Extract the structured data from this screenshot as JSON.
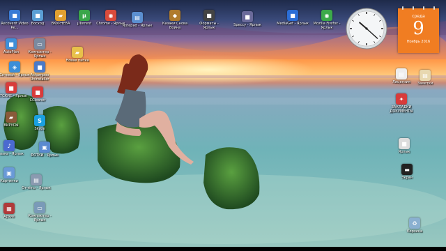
{
  "clock": {
    "time": "10:22"
  },
  "calendar": {
    "weekday": "среда",
    "day": "9",
    "month_year": "Ноябрь 2016"
  },
  "colors": {
    "calendar": "#f07d22",
    "sky_top": "#1e2a4a",
    "sunset": "#ff9a4a",
    "sea": "#6fb3b8"
  },
  "icons": [
    {
      "label": "Recoverit Video Re...",
      "icon": "app-icon",
      "color": "#3a7bd5"
    },
    {
      "label": "Восход",
      "icon": "app-icon",
      "color": "#5a9fd4"
    },
    {
      "label": "ВКУРНЕВА",
      "icon": "folder-icon",
      "color": "#e0a030"
    },
    {
      "label": "µTorrent",
      "icon": "torrent-icon",
      "color": "#3aa64a"
    },
    {
      "label": "Chrome - Ярлык",
      "icon": "browser-icon",
      "color": "#d94b3b"
    },
    {
      "label": "Notepad - Ярлык",
      "icon": "document-icon",
      "color": "#5b8fd0"
    },
    {
      "label": "Казаки Снова Война",
      "icon": "game-icon",
      "color": "#b07b2c"
    },
    {
      "label": "Форматы - Ярлык",
      "icon": "app-icon",
      "color": "#444444"
    },
    {
      "label": "Speccy - Ярлык",
      "icon": "app-icon",
      "color": "#6a6a9a"
    },
    {
      "label": "MediaGet - Ярлык",
      "icon": "app-icon",
      "color": "#2b6ed6"
    },
    {
      "label": "Mozilla Firefox - Ярлык",
      "icon": "browser-icon",
      "color": "#3caa4a"
    },
    {
      "label": "AutoPlan",
      "icon": "app-icon",
      "color": "#3f8fd8"
    },
    {
      "label": "Компьютер - Ярлык",
      "icon": "computer-icon",
      "color": "#7a8aa0"
    },
    {
      "label": "Новая папка",
      "icon": "folder-icon",
      "color": "#e8c14a"
    },
    {
      "label": "Сетевой - Ярлык",
      "icon": "network-icon",
      "color": "#3d8ed8"
    },
    {
      "label": "Ashampoo Uninstaller",
      "icon": "app-icon",
      "color": "#4a7ac8"
    },
    {
      "label": "ДЕТСКИЕ - Ярлык",
      "icon": "app-icon",
      "color": "#d83b3b"
    },
    {
      "label": "CCleaner",
      "icon": "app-icon",
      "color": "#d83b3b"
    },
    {
      "label": "ВИРУСЫ",
      "icon": "folder-icon",
      "color": "#8a5a3a"
    },
    {
      "label": "Skype",
      "icon": "skype-icon",
      "color": "#1aa0e0"
    },
    {
      "label": "Музыка - Ярлык",
      "icon": "music-icon",
      "color": "#4a6ad0"
    },
    {
      "label": "ФОТКИ - Ярлык",
      "icon": "photos-icon",
      "color": "#5a8ad0"
    },
    {
      "label": "Картинки",
      "icon": "pictures-icon",
      "color": "#6a9ad8"
    },
    {
      "label": "Отчёты - Ярлык",
      "icon": "document-icon",
      "color": "#8a9ab0"
    },
    {
      "label": "Архив",
      "icon": "archive-icon",
      "color": "#b03a3a"
    },
    {
      "label": "Компьютер - Ярлык",
      "icon": "computer-icon",
      "color": "#7a9ab8"
    },
    {
      "label": "Лицензия",
      "icon": "document-icon",
      "color": "#eeeeee"
    },
    {
      "label": "Заметки",
      "icon": "notes-icon",
      "color": "#e8d8b0"
    },
    {
      "label": "ЗАКЛАДКИ ДОКУМЕНТЫ",
      "icon": "bookmark-icon",
      "color": "#d83b3b"
    },
    {
      "label": "Ярлык",
      "icon": "app-icon",
      "color": "#dddddd"
    },
    {
      "label": "Экран",
      "icon": "screen-icon",
      "color": "#222222"
    },
    {
      "label": "Корзина",
      "icon": "recycle-bin-icon",
      "color": "#8ab0d0"
    }
  ]
}
